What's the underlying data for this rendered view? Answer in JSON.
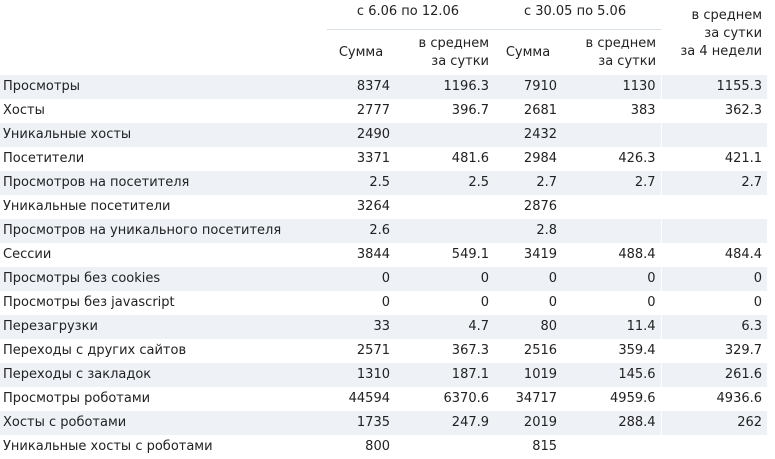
{
  "periods": [
    {
      "title": "с 6.06 по 12.06"
    },
    {
      "title": "с 30.05 по 5.06"
    }
  ],
  "avg4_heading": {
    "line1": "в среднем",
    "line2": "за сутки",
    "line3": "за 4 недели"
  },
  "sub_headers": {
    "sum": "Сумма",
    "avg_line1": "в среднем",
    "avg_line2": "за сутки"
  },
  "rows": [
    {
      "label": "Просмотры",
      "sum1": "8374",
      "avg1": "1196.3",
      "sum2": "7910",
      "avg2": "1130",
      "avg4": "1155.3"
    },
    {
      "label": "Хосты",
      "sum1": "2777",
      "avg1": "396.7",
      "sum2": "2681",
      "avg2": "383",
      "avg4": "362.3"
    },
    {
      "label": "Уникальные хосты",
      "sum1": "2490",
      "avg1": "",
      "sum2": "2432",
      "avg2": "",
      "avg4": ""
    },
    {
      "label": "Посетители",
      "sum1": "3371",
      "avg1": "481.6",
      "sum2": "2984",
      "avg2": "426.3",
      "avg4": "421.1"
    },
    {
      "label": "Просмотров на посетителя",
      "sum1": "2.5",
      "avg1": "2.5",
      "sum2": "2.7",
      "avg2": "2.7",
      "avg4": "2.7"
    },
    {
      "label": "Уникальные посетители",
      "sum1": "3264",
      "avg1": "",
      "sum2": "2876",
      "avg2": "",
      "avg4": ""
    },
    {
      "label": "Просмотров на уникального посетителя",
      "sum1": "2.6",
      "avg1": "",
      "sum2": "2.8",
      "avg2": "",
      "avg4": ""
    },
    {
      "label": "Сессии",
      "sum1": "3844",
      "avg1": "549.1",
      "sum2": "3419",
      "avg2": "488.4",
      "avg4": "484.4"
    },
    {
      "label": "Просмотры без cookies",
      "sum1": "0",
      "avg1": "0",
      "sum2": "0",
      "avg2": "0",
      "avg4": "0"
    },
    {
      "label": "Просмотры без javascript",
      "sum1": "0",
      "avg1": "0",
      "sum2": "0",
      "avg2": "0",
      "avg4": "0"
    },
    {
      "label": "Перезагрузки",
      "sum1": "33",
      "avg1": "4.7",
      "sum2": "80",
      "avg2": "11.4",
      "avg4": "6.3"
    },
    {
      "label": "Переходы с других сайтов",
      "sum1": "2571",
      "avg1": "367.3",
      "sum2": "2516",
      "avg2": "359.4",
      "avg4": "329.7"
    },
    {
      "label": "Переходы с закладок",
      "sum1": "1310",
      "avg1": "187.1",
      "sum2": "1019",
      "avg2": "145.6",
      "avg4": "261.6"
    },
    {
      "label": "Просмотры роботами",
      "sum1": "44594",
      "avg1": "6370.6",
      "sum2": "34717",
      "avg2": "4959.6",
      "avg4": "4936.6"
    },
    {
      "label": "Хосты с роботами",
      "sum1": "1735",
      "avg1": "247.9",
      "sum2": "2019",
      "avg2": "288.4",
      "avg4": "262"
    },
    {
      "label": "Уникальные хосты с роботами",
      "sum1": "800",
      "avg1": "",
      "sum2": "815",
      "avg2": "",
      "avg4": ""
    }
  ]
}
